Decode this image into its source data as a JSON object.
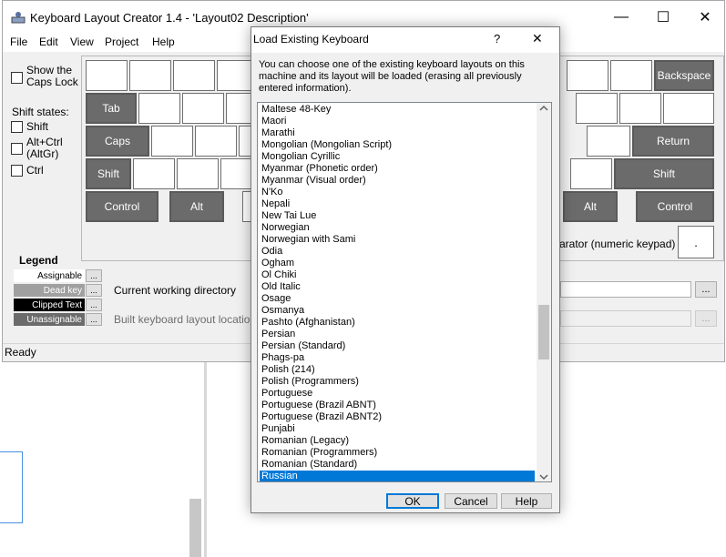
{
  "app": {
    "title": "Keyboard Layout Creator 1.4 - 'Layout02 Description'",
    "caption_minimize": "—",
    "caption_maximize": "☐",
    "caption_close": "✕"
  },
  "menu": [
    "File",
    "Edit",
    "View",
    "Project",
    "Help"
  ],
  "left_panel": {
    "caps_lock_label": "Show the\nCaps Lock",
    "shift_states_label": "Shift states:",
    "shift_label": "Shift",
    "altctrl_label": "Alt+Ctrl\n(AltGr)",
    "ctrl_label": "Ctrl"
  },
  "keys": {
    "backspace": "Backspace",
    "tab": "Tab",
    "caps": "Caps",
    "return": "Return",
    "shift_left": "Shift",
    "shift_right": "Shift",
    "control_left": "Control",
    "alt_left": "Alt",
    "alt_right": "Alt",
    "control_right": "Control",
    "decimal": "."
  },
  "separator_label": "arator (numeric keypad)",
  "legend": {
    "title": "Legend",
    "assignable": "Assignable",
    "dead_key": "Dead key",
    "clipped_text": "Clipped Text",
    "unassignable": "Unassignable",
    "btn": "..."
  },
  "paths": {
    "cwd_label": "Current working directory",
    "built_label": "Built keyboard layout location",
    "btn": "..."
  },
  "status": "Ready",
  "dialog": {
    "title": "Load Existing Keyboard",
    "help": "?",
    "close": "✕",
    "description": "You can choose one of the existing  keyboard layouts on this machine and its layout will be loaded (erasing all previously entered information).",
    "items": [
      "Maltese 48-Key",
      "Maori",
      "Marathi",
      "Mongolian (Mongolian Script)",
      "Mongolian Cyrillic",
      "Myanmar (Phonetic order)",
      "Myanmar (Visual order)",
      "N'Ko",
      "Nepali",
      "New Tai Lue",
      "Norwegian",
      "Norwegian with Sami",
      "Odia",
      "Ogham",
      "Ol Chiki",
      "Old Italic",
      "Osage",
      "Osmanya",
      "Pashto (Afghanistan)",
      "Persian",
      "Persian (Standard)",
      "Phags-pa",
      "Polish (214)",
      "Polish (Programmers)",
      "Portuguese",
      "Portuguese (Brazil ABNT)",
      "Portuguese (Brazil ABNT2)",
      "Punjabi",
      "Romanian (Legacy)",
      "Romanian (Programmers)",
      "Romanian (Standard)",
      "Russian"
    ],
    "selected": "Russian",
    "ok": "OK",
    "cancel": "Cancel",
    "help_btn": "Help"
  },
  "colors": {
    "selection": "#0078d7",
    "key_dark": "#6b6b6b"
  }
}
